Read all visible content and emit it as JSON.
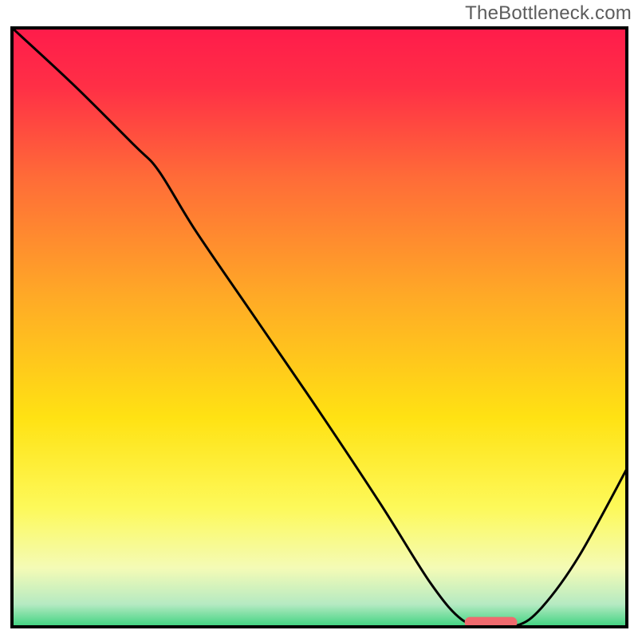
{
  "watermark": "TheBottleneck.com",
  "chart_data": {
    "type": "line",
    "title": "",
    "xlabel": "",
    "ylabel": "",
    "xlim": [
      0,
      100
    ],
    "ylim": [
      0,
      100
    ],
    "background": {
      "type": "gradient",
      "stops": [
        {
          "pos": 0.0,
          "color": "#ff1b4b"
        },
        {
          "pos": 0.1,
          "color": "#ff2f46"
        },
        {
          "pos": 0.25,
          "color": "#ff6b38"
        },
        {
          "pos": 0.45,
          "color": "#ffaa26"
        },
        {
          "pos": 0.65,
          "color": "#ffe213"
        },
        {
          "pos": 0.8,
          "color": "#fdf95a"
        },
        {
          "pos": 0.9,
          "color": "#f4fbb6"
        },
        {
          "pos": 0.96,
          "color": "#b5eac2"
        },
        {
          "pos": 1.0,
          "color": "#34d17a"
        }
      ]
    },
    "series": [
      {
        "name": "curve",
        "color": "#000000",
        "x": [
          0,
          10,
          20,
          24,
          30,
          40,
          50,
          60,
          68,
          73,
          77,
          82,
          86,
          92,
          100
        ],
        "y": [
          100,
          90.5,
          80.3,
          76,
          66,
          51,
          36,
          20.5,
          7.5,
          1.5,
          0.5,
          0.5,
          3.5,
          12,
          27
        ]
      }
    ],
    "markers": [
      {
        "name": "target-pill",
        "shape": "pill",
        "color": "#ef6a6e",
        "x_start": 73.5,
        "x_end": 82.0,
        "y": 1.0,
        "thickness_pct": 1.8
      }
    ],
    "axes": {
      "show_border": true,
      "border_color": "#000000",
      "border_width": 4,
      "show_ticks": false,
      "show_grid": false
    }
  }
}
